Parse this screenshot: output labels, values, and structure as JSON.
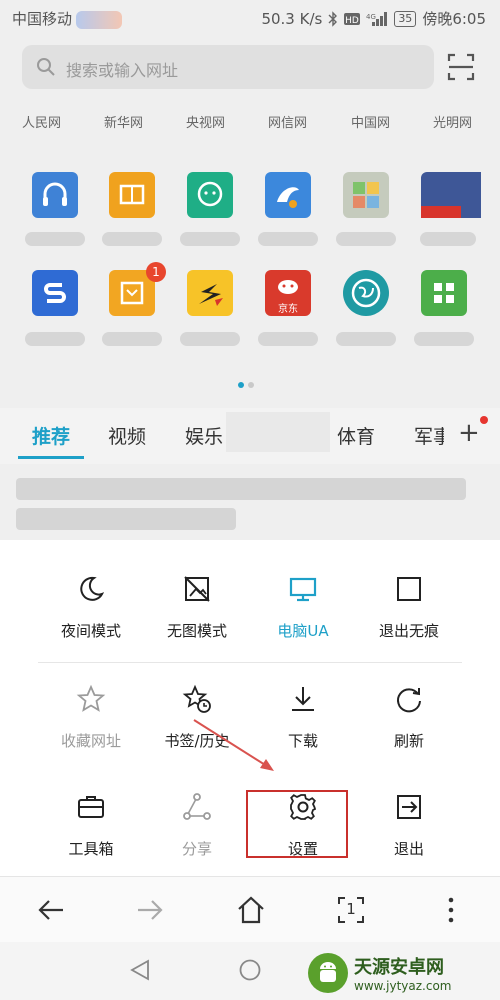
{
  "status_bar": {
    "carrier": "中国移动",
    "speed": "50.3 K/s",
    "battery": "35",
    "time": "傍晚6:05"
  },
  "search": {
    "placeholder": "搜索或输入网址"
  },
  "quick_sites": [
    "人民网",
    "新华网",
    "央视网",
    "网信网",
    "中国网",
    "光明网"
  ],
  "apps": {
    "row1": [
      {
        "icon": "headphones-icon",
        "color": "#3f82d6"
      },
      {
        "icon": "book-icon",
        "color": "#f0a21e"
      },
      {
        "icon": "chat-face-icon",
        "color": "#1fae86"
      },
      {
        "icon": "dolphin-icon",
        "color": "#3c88dc"
      },
      {
        "icon": "colorful-grid-icon",
        "color": "#bfc6b3"
      },
      {
        "icon": "red-banner-icon",
        "color": "#3e5797"
      }
    ],
    "row2": [
      {
        "icon": "s-letter-icon",
        "color": "#2f6bd4"
      },
      {
        "icon": "box-icon",
        "color": "#f2a622",
        "badge": "1"
      },
      {
        "icon": "s-swoosh-icon",
        "color": "#f7c328"
      },
      {
        "icon": "jd-dog-icon",
        "color": "#d93a2c",
        "text": "京东"
      },
      {
        "icon": "globe-icon",
        "color": "#1f9aa3"
      },
      {
        "icon": "four-squares-icon",
        "color": "#4cae4a"
      }
    ]
  },
  "news_tabs": [
    "推荐",
    "视频",
    "娱乐",
    "体育",
    "军事"
  ],
  "menu": {
    "row1": [
      {
        "label": "夜间模式",
        "icon": "moon-icon",
        "state": "normal"
      },
      {
        "label": "无图模式",
        "icon": "no-image-icon",
        "state": "normal"
      },
      {
        "label": "电脑UA",
        "icon": "monitor-icon",
        "state": "active"
      },
      {
        "label": "退出无痕",
        "icon": "square-icon",
        "state": "normal"
      }
    ],
    "row2": [
      {
        "label": "收藏网址",
        "icon": "star-icon",
        "state": "disabled"
      },
      {
        "label": "书签/历史",
        "icon": "star-clock-icon",
        "state": "normal"
      },
      {
        "label": "下载",
        "icon": "download-icon",
        "state": "normal"
      },
      {
        "label": "刷新",
        "icon": "refresh-icon",
        "state": "normal"
      }
    ],
    "row3": [
      {
        "label": "工具箱",
        "icon": "toolbox-icon",
        "state": "normal"
      },
      {
        "label": "分享",
        "icon": "share-icon",
        "state": "disabled"
      },
      {
        "label": "设置",
        "icon": "gear-icon",
        "state": "highlighted"
      },
      {
        "label": "退出",
        "icon": "exit-icon",
        "state": "normal"
      }
    ]
  },
  "toolbar": {
    "tab_count": "1"
  },
  "watermark": {
    "title": "天源安卓网",
    "url": "www.jytyaz.com"
  },
  "colors": {
    "accent": "#1ea0c8",
    "highlight_box": "#c9302c",
    "arrow": "#d9534f",
    "badge": "#e8462d"
  }
}
